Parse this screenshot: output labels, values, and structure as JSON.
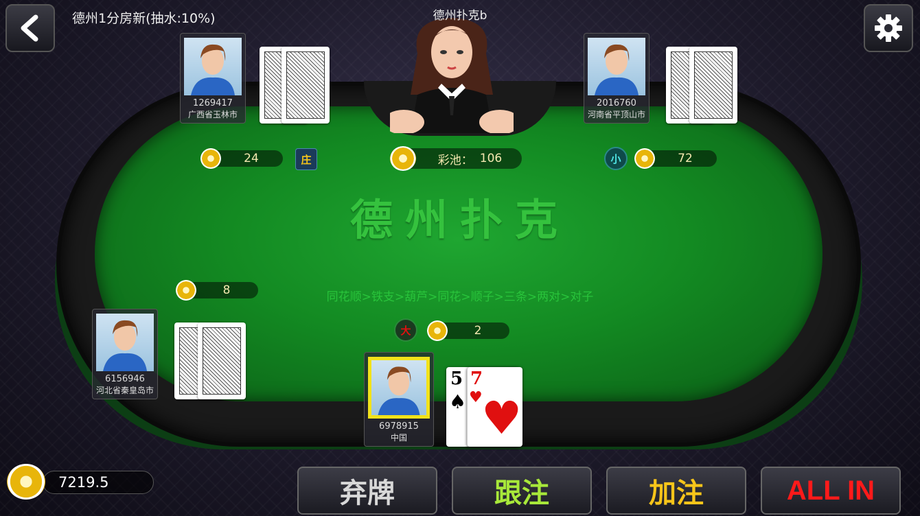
{
  "header": {
    "room_title": "德州1分房新(抽水:10%)",
    "game_name": "德州扑克b"
  },
  "table": {
    "felt_title": "德州扑克",
    "hand_rankings": "同花顺>铁支>葫芦>同花>顺子>三条>两对>对子",
    "pot_label": "彩池：",
    "pot_value": "106"
  },
  "players": {
    "top_left": {
      "id": "1269417",
      "location": "广西省玉林市",
      "bet": "24",
      "marker": "庄"
    },
    "top_right": {
      "id": "2016760",
      "location": "河南省平顶山市",
      "bet": "72",
      "marker": "小"
    },
    "left": {
      "id": "6156946",
      "location": "河北省秦皇岛市",
      "bet": "8"
    },
    "self": {
      "id": "6978915",
      "location": "中国",
      "bet": "2",
      "marker": "大"
    }
  },
  "hand": [
    {
      "rank": "5",
      "suit": "♠",
      "color": "#000"
    },
    {
      "rank": "7",
      "suit": "♥",
      "color": "#e01010"
    }
  ],
  "balance": "7219.5",
  "actions": {
    "fold": "弃牌",
    "call": "跟注",
    "raise": "加注",
    "all_in": "ALL IN"
  },
  "colors": {
    "fold": "#d8d8d8",
    "call": "#a8e83a",
    "raise": "#f7c51a",
    "all_in": "#ff1a1a"
  }
}
